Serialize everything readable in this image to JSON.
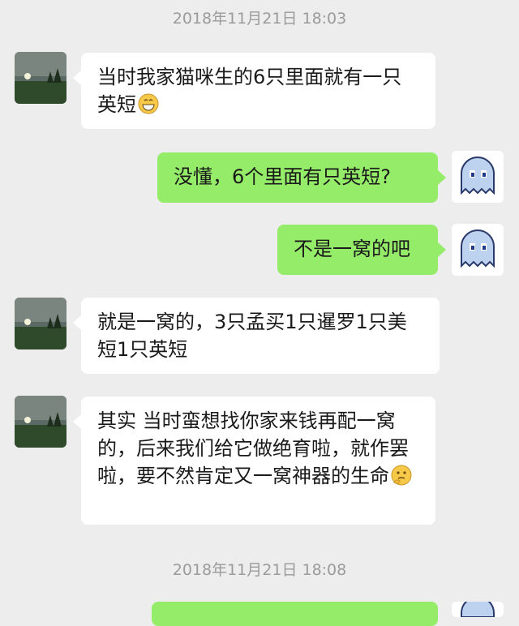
{
  "timestamps": [
    "2018年11月21日 18:03",
    "2018年11月21日 18:08"
  ],
  "messages": [
    {
      "side": "in",
      "text": "当时我家猫咪生的6只里面就有一只英短",
      "emoji": "grinning-face-emoji"
    },
    {
      "side": "out",
      "text": "没懂，6个里面有只英短?"
    },
    {
      "side": "out",
      "text": "不是一窝的吧"
    },
    {
      "side": "in",
      "text": "就是一窝的，3只孟买1只暹罗1只美短1只英短"
    },
    {
      "side": "in",
      "text": "其实 当时蛮想找你家来钱再配一窝的，后来我们给它做绝育啦，就作罢啦，要不然肯定又一窝神器的生命",
      "emoji": "thinking-face-emoji"
    }
  ],
  "colors": {
    "background": "#ededed",
    "incoming_bubble": "#ffffff",
    "outgoing_bubble": "#95ec69",
    "timestamp": "#9b9b9b"
  },
  "avatars": {
    "contact": "landscape-night-avatar",
    "self": "pacman-ghost-avatar"
  }
}
